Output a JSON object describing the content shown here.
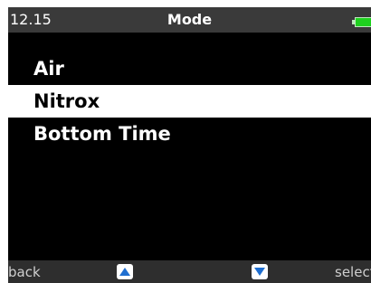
{
  "status_bar": {
    "time": "12.15",
    "title": "Mode",
    "battery_icon": "battery-icon",
    "battery_color": "#1fd11f"
  },
  "menu": {
    "items": [
      {
        "label": "Air",
        "selected": false
      },
      {
        "label": "Nitrox",
        "selected": true
      },
      {
        "label": "Bottom Time",
        "selected": false
      }
    ]
  },
  "softkeys": {
    "left_label": "back",
    "up_icon": "up-arrow-icon",
    "down_icon": "down-arrow-icon",
    "right_label": "select",
    "arrow_color": "#1f6fd1"
  }
}
